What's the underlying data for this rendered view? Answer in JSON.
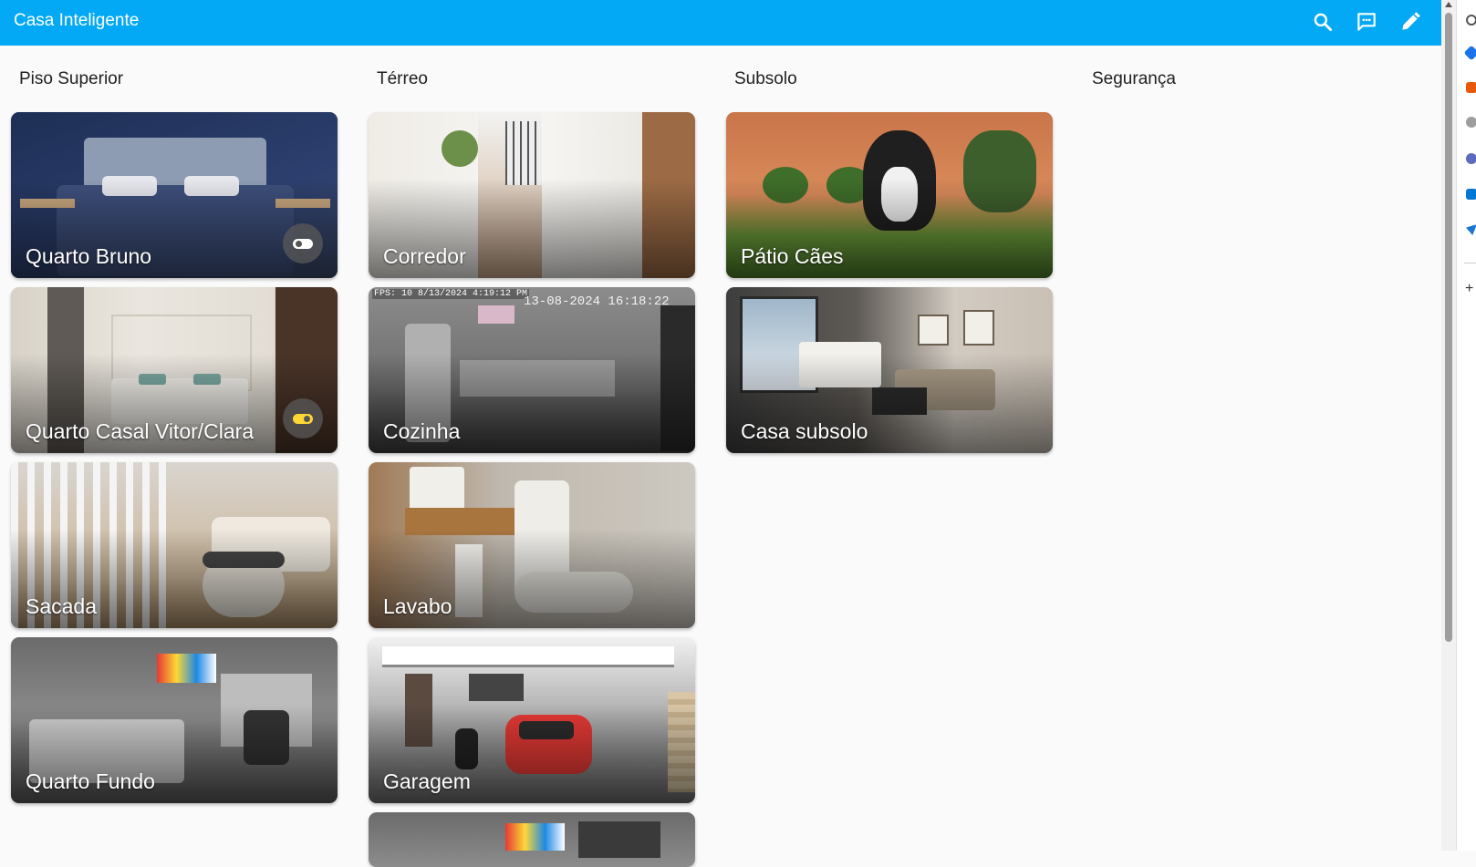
{
  "app": {
    "title": "Casa Inteligente"
  },
  "toolbar": {
    "icons": [
      "search-icon",
      "chat-icon",
      "pencil-icon"
    ]
  },
  "columns": [
    {
      "title": "Piso Superior",
      "cards": [
        {
          "label": "Quarto Bruno",
          "toggle": "off"
        },
        {
          "label": "Quarto Casal Vitor/Clara",
          "toggle": "on"
        },
        {
          "label": "Sacada"
        },
        {
          "label": "Quarto Fundo"
        }
      ]
    },
    {
      "title": "Térreo",
      "cards": [
        {
          "label": "Corredor"
        },
        {
          "label": "Cozinha",
          "overlay": {
            "fps": "FPS: 10 8/13/2024 4:19:12 PM",
            "timestamp": "13-08-2024 16:18:22"
          }
        },
        {
          "label": "Lavabo"
        },
        {
          "label": "Garagem"
        },
        {
          "label": ""
        }
      ]
    },
    {
      "title": "Subsolo",
      "cards": [
        {
          "label": "Pátio Cães"
        },
        {
          "label": "Casa subsolo"
        }
      ]
    },
    {
      "title": "Segurança",
      "cards": []
    }
  ],
  "colors": {
    "header": "#03a9f4",
    "toggle_on": "#fdd835",
    "toggle_off": "#ffffff"
  }
}
